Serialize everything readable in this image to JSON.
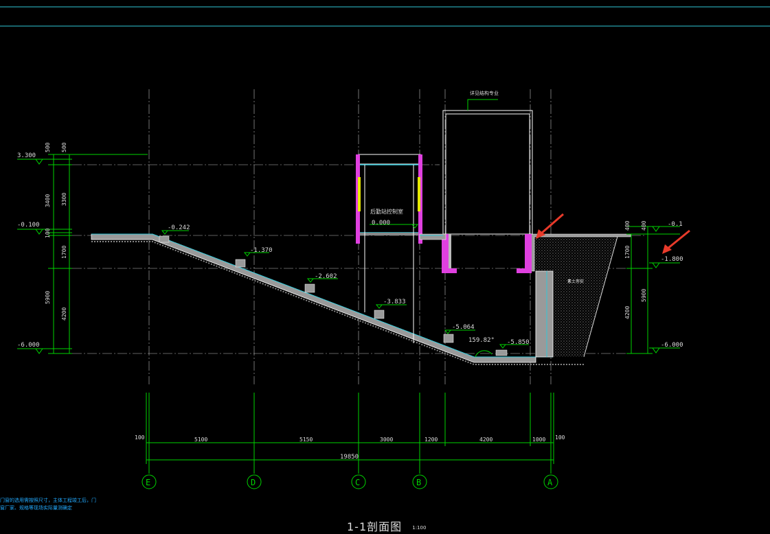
{
  "drawing": {
    "title": "1-1剖面图",
    "scale": "1:100",
    "notes": [
      "门窗的选用需按照尺寸，主体工程竣工后，门",
      "窗厂家、规格等现场实际量测确定"
    ]
  },
  "colors": {
    "background": "#000000",
    "gridline": "#bfbfbf",
    "dimension": "#00d400",
    "structure": "#ffffff",
    "cyan": "#30c8d8",
    "magenta": "#e040e0",
    "yellow": "#e8e800",
    "arrow": "#e83a2a",
    "soil_hatch": "#b0b0b0"
  },
  "labels": {
    "room_small": "后勤站控制室",
    "room_large": "详见结构专业",
    "soil": "素土夯实 ",
    "angle": "159.82°",
    "elev_room": "0.000"
  },
  "elevations": [
    {
      "id": "e-neg0242",
      "text": "-0.242"
    },
    {
      "id": "e-neg1370",
      "text": "-1.370"
    },
    {
      "id": "e-neg2602",
      "text": "-2.602"
    },
    {
      "id": "e-neg3833",
      "text": "-3.833"
    },
    {
      "id": "e-neg5064",
      "text": "-5.064"
    },
    {
      "id": "e-neg5850",
      "text": "-5.850"
    }
  ],
  "left_levels": [
    "3.300",
    "-0.100",
    "-6.000"
  ],
  "right_levels": [
    "-0.1",
    "-1.800",
    "-6.000"
  ],
  "left_dims_outer": [
    "500",
    "3400",
    "100",
    "5900"
  ],
  "left_dims_inner": [
    "500",
    "3300",
    "1700",
    "4200"
  ],
  "right_dims_outer": [
    "400",
    "5900"
  ],
  "right_dims_inner": [
    "400",
    "1700",
    "4200"
  ],
  "bottom_dims": [
    "100",
    "5100",
    "5150",
    "3000",
    "1200",
    "4200",
    "1000",
    "100"
  ],
  "total_dim": "19850",
  "axes": [
    "E",
    "D",
    "C",
    "B",
    "A"
  ]
}
